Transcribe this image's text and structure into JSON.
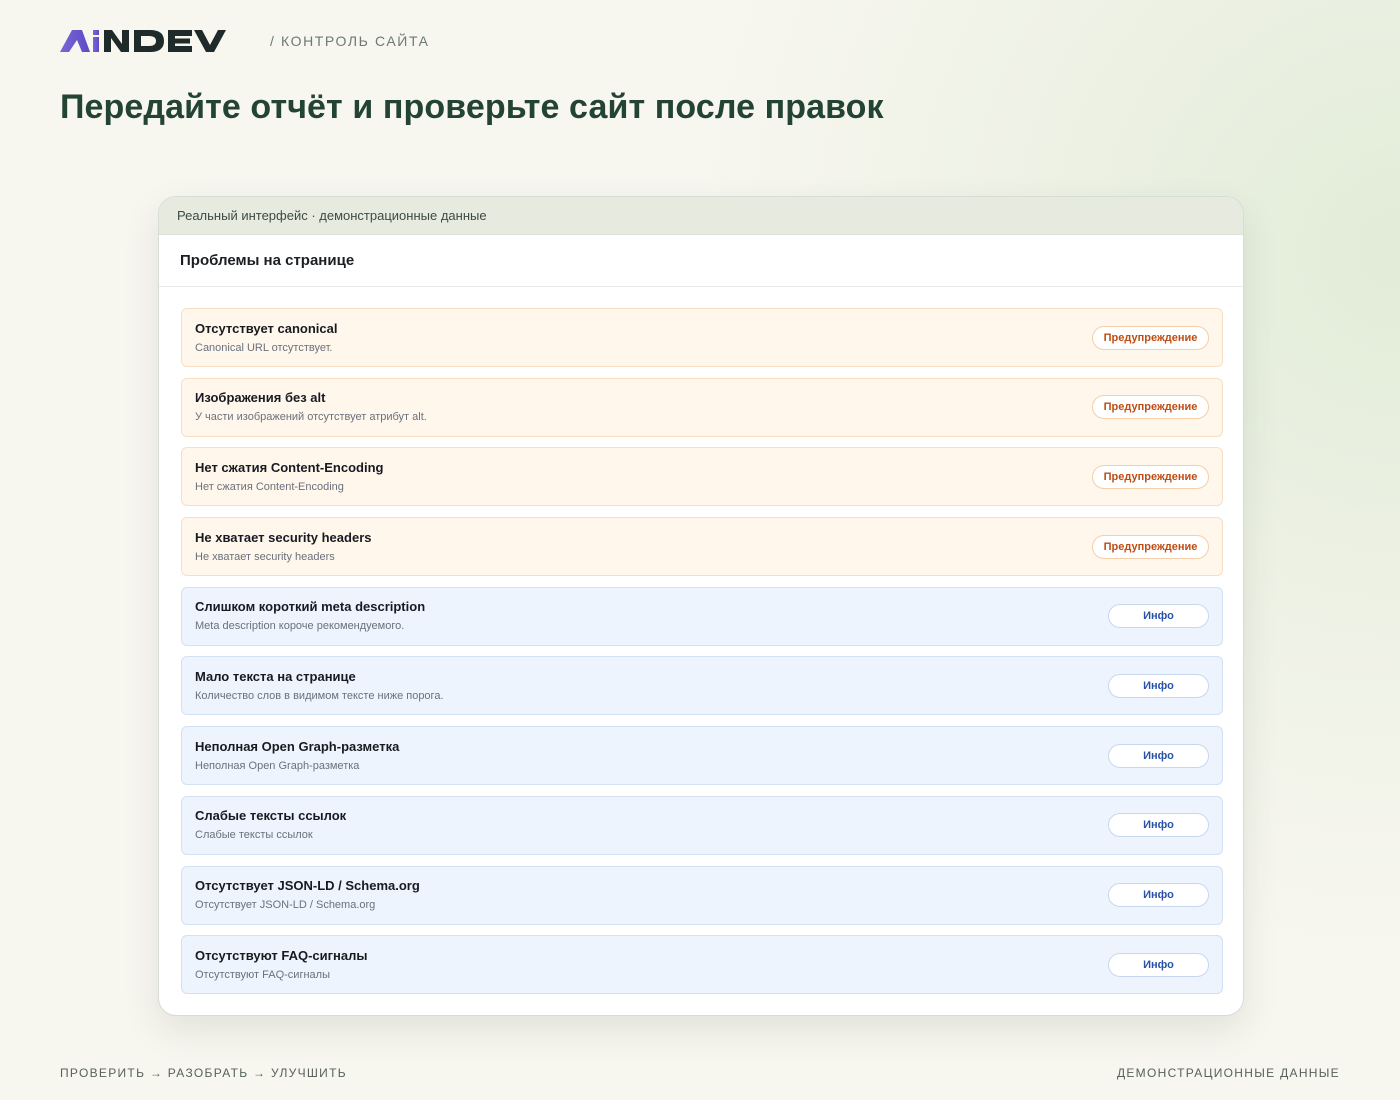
{
  "header": {
    "logo": {
      "text": "AiNDEV",
      "color_accent": "#6a5acd",
      "color_main": "#1f2a2b"
    },
    "section": "/ КОНТРОЛЬ САЙТА"
  },
  "page": {
    "title": "Передайте отчёт и проверьте сайт после правок"
  },
  "panel": {
    "caption": "Реальный интерфейс · демонстрационные данные",
    "heading": "Проблемы на странице",
    "issues": [
      {
        "title": "Отсутствует canonical",
        "desc": "Canonical URL отсутствует.",
        "badge": "Предупреждение",
        "level": "warning"
      },
      {
        "title": "Изображения без alt",
        "desc": "У части изображений отсутствует атрибут alt.",
        "badge": "Предупреждение",
        "level": "warning"
      },
      {
        "title": "Нет сжатия Content-Encoding",
        "desc": "Нет сжатия Content-Encoding",
        "badge": "Предупреждение",
        "level": "warning"
      },
      {
        "title": "Не хватает security headers",
        "desc": "Не хватает security headers",
        "badge": "Предупреждение",
        "level": "warning"
      },
      {
        "title": "Слишком короткий meta description",
        "desc": "Meta description короче рекомендуемого.",
        "badge": "Инфо",
        "level": "info"
      },
      {
        "title": "Мало текста на странице",
        "desc": "Количество слов в видимом тексте ниже порога.",
        "badge": "Инфо",
        "level": "info"
      },
      {
        "title": "Неполная Open Graph-разметка",
        "desc": "Неполная Open Graph-разметка",
        "badge": "Инфо",
        "level": "info"
      },
      {
        "title": "Слабые тексты ссылок",
        "desc": "Слабые тексты ссылок",
        "badge": "Инфо",
        "level": "info"
      },
      {
        "title": "Отсутствует JSON-LD / Schema.org",
        "desc": "Отсутствует JSON-LD / Schema.org",
        "badge": "Инфо",
        "level": "info"
      },
      {
        "title": "Отсутствуют FAQ-сигналы",
        "desc": "Отсутствуют FAQ-сигналы",
        "badge": "Инфо",
        "level": "info"
      }
    ]
  },
  "footer": {
    "left": "ПРОВЕРИТЬ → РАЗОБРАТЬ → УЛУЧШИТЬ",
    "right": "ДЕМОНСТРАЦИОННЫЕ ДАННЫЕ"
  },
  "colors": {
    "title": "#234334",
    "warning_text": "#be4d14",
    "warning_bg": "#fff6ec",
    "info_text": "#2a51a8",
    "info_bg": "#eef4fd"
  }
}
